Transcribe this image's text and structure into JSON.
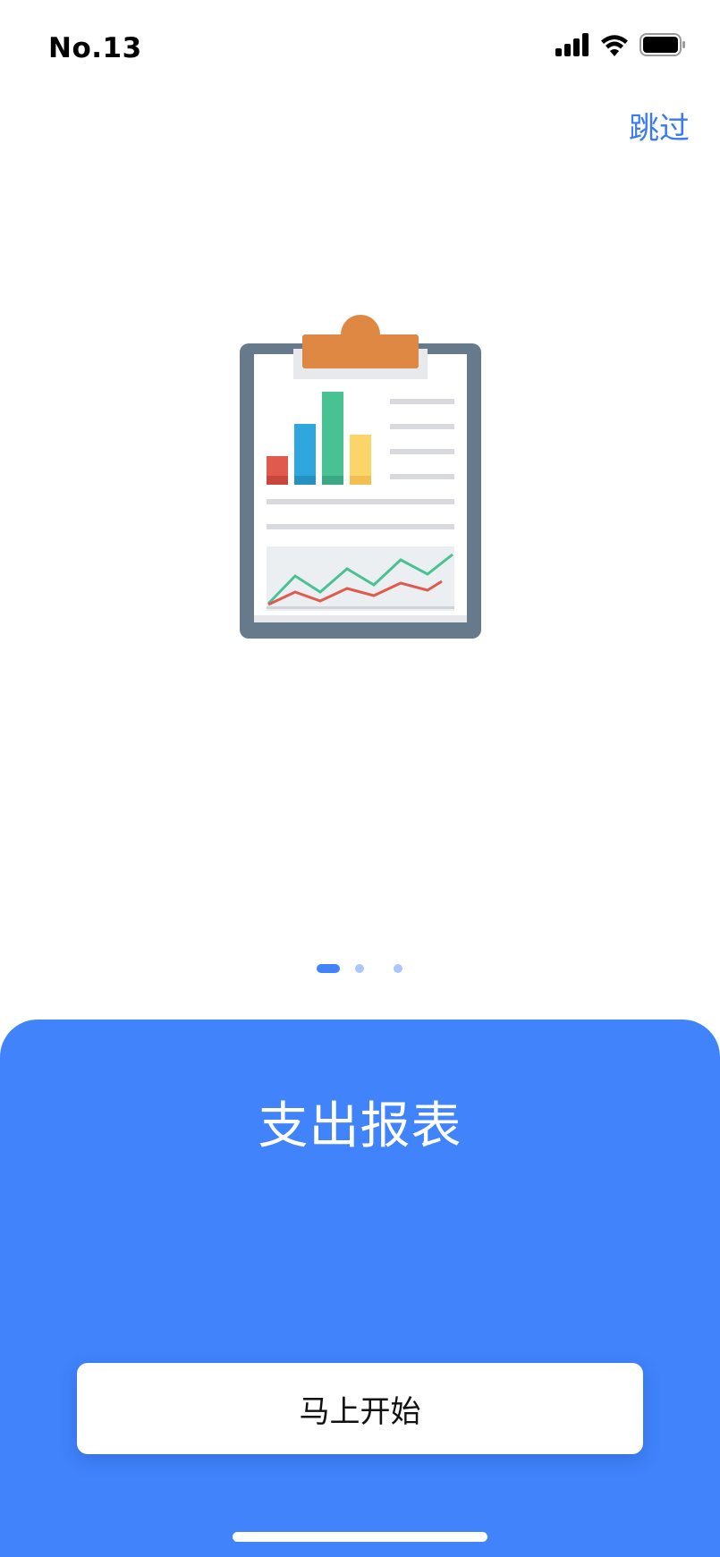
{
  "status_bar": {
    "time": "No.13",
    "icons": [
      "signal-icon",
      "wifi-icon",
      "battery-icon"
    ]
  },
  "header": {
    "skip_label": "跳过"
  },
  "illustration": {
    "icon": "clipboard-report-icon"
  },
  "pagination": {
    "total": 3,
    "current": 1
  },
  "sheet": {
    "title": "支出报表",
    "start_button_label": "马上开始"
  },
  "colors": {
    "accent": "#4083FB",
    "accent_link": "#3B7BF0",
    "dot_inactive": "#A9C7FC",
    "white": "#FFFFFF",
    "clipboard_frame": "#677A8B",
    "clip_orange": "#DE8843",
    "bar_red": "#E05A4E",
    "bar_blue": "#2FA6DE",
    "bar_green": "#48C193",
    "bar_yellow": "#FCD568",
    "line_gray": "#D7D9DE"
  }
}
